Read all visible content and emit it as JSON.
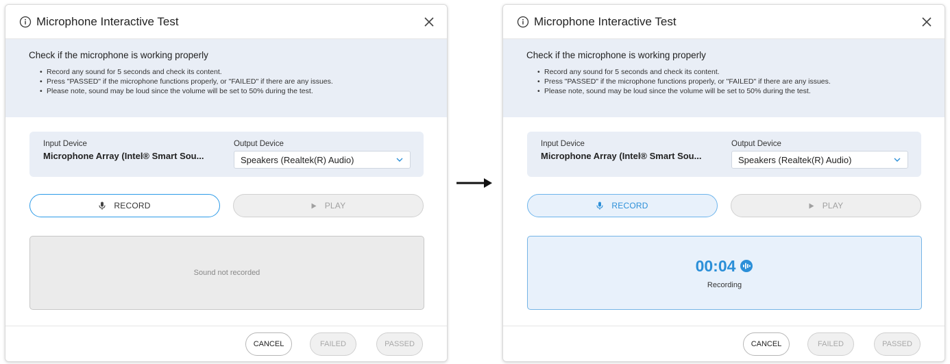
{
  "dialogs": [
    {
      "title": "Microphone Interactive Test",
      "description": {
        "heading": "Check if the microphone is working properly",
        "bullets": [
          "Record any sound for 5 seconds and check its content.",
          "Press \"PASSED\" if the microphone functions properly, or \"FAILED\" if there are any issues.",
          "Please note, sound may be loud since the volume will be set to 50% during the test."
        ]
      },
      "input_device": {
        "label": "Input Device",
        "value": "Microphone Array (Intel® Smart Sou..."
      },
      "output_device": {
        "label": "Output Device",
        "selected": "Speakers (Realtek(R) Audio)"
      },
      "record_label": "RECORD",
      "play_label": "PLAY",
      "panel_text": "Sound not recorded",
      "footer": {
        "cancel": "CANCEL",
        "failed": "FAILED",
        "passed": "PASSED"
      }
    },
    {
      "title": "Microphone Interactive Test",
      "description": {
        "heading": "Check if the microphone is working properly",
        "bullets": [
          "Record any sound for 5 seconds and check its content.",
          "Press \"PASSED\" if the microphone functions properly, or \"FAILED\" if there are any issues.",
          "Please note, sound may be loud since the volume will be set to 50% during the test."
        ]
      },
      "input_device": {
        "label": "Input Device",
        "value": "Microphone Array (Intel® Smart Sou..."
      },
      "output_device": {
        "label": "Output Device",
        "selected": "Speakers (Realtek(R) Audio)"
      },
      "record_label": "RECORD",
      "play_label": "PLAY",
      "timer": "00:04",
      "status": "Recording",
      "footer": {
        "cancel": "CANCEL",
        "failed": "FAILED",
        "passed": "PASSED"
      }
    }
  ],
  "icons": {
    "info": "info-icon",
    "close": "close-icon",
    "microphone": "microphone-icon",
    "play": "play-icon",
    "chevron": "chevron-down-icon",
    "audio_wave": "audio-wave-icon",
    "arrow": "right-arrow-icon"
  },
  "colors": {
    "accent": "#2b8fd8",
    "info_bg": "#e9eef6",
    "disabled": "#a8a8a8"
  }
}
